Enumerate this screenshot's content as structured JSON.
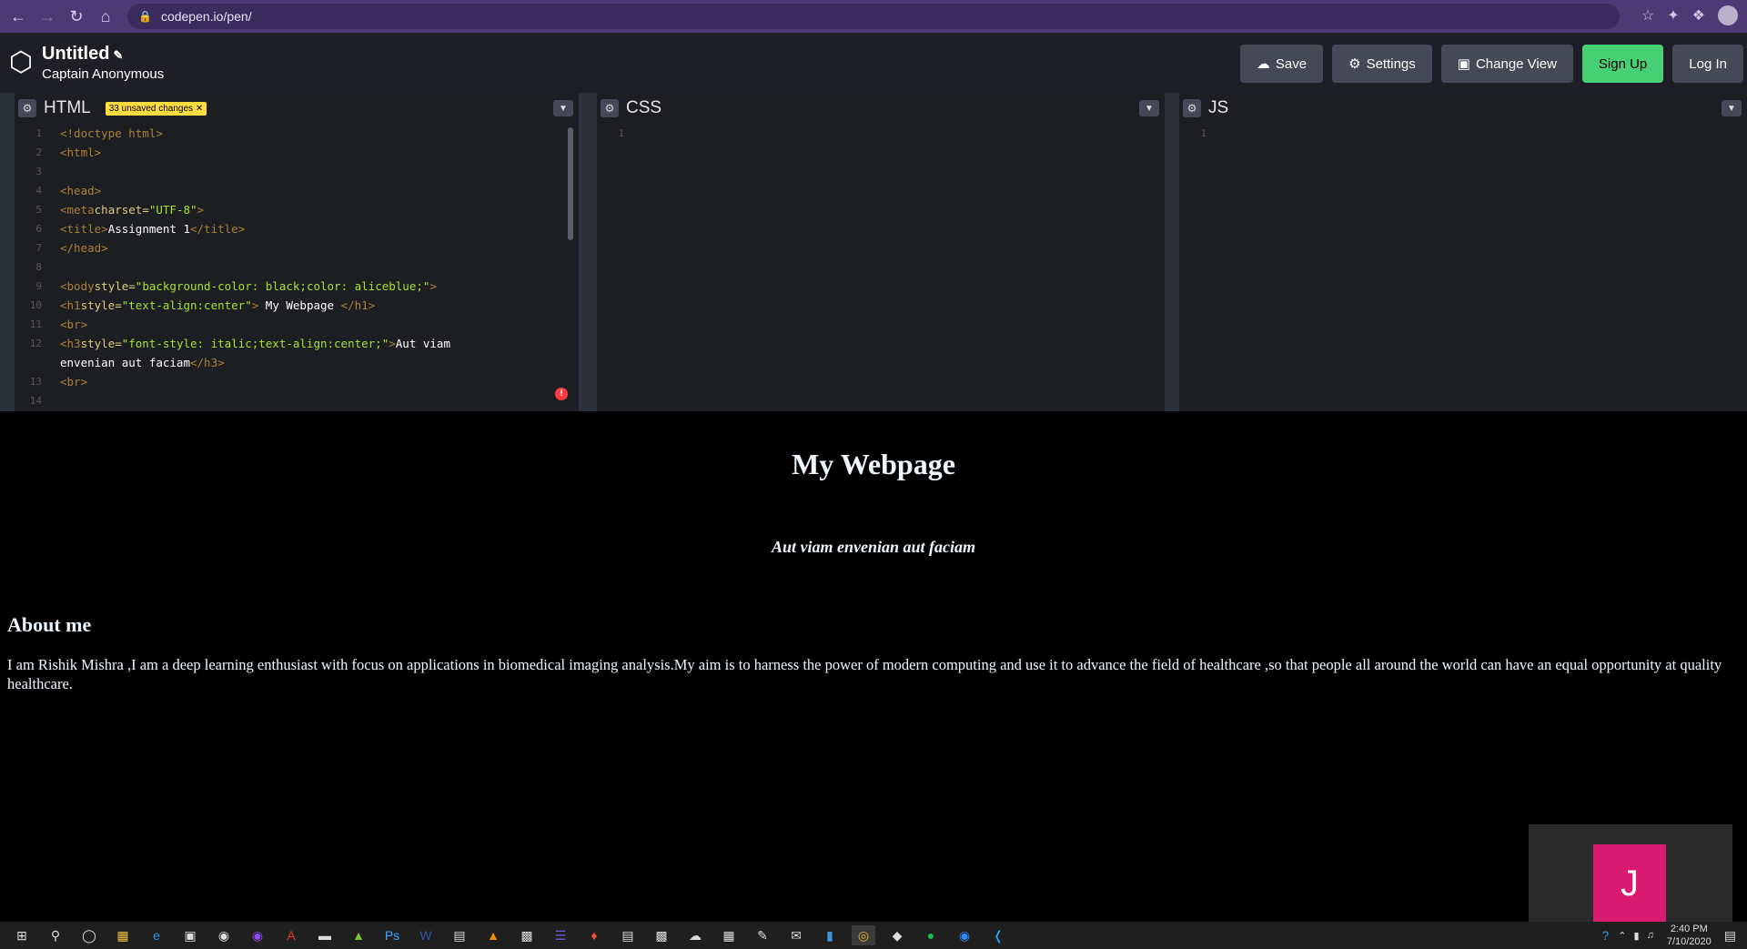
{
  "browser": {
    "url": "codepen.io/pen/"
  },
  "header": {
    "title": "Untitled",
    "author": "Captain Anonymous",
    "buttons": {
      "save": "Save",
      "settings": "Settings",
      "change_view": "Change View",
      "signup": "Sign Up",
      "login": "Log In"
    }
  },
  "editors": {
    "html": {
      "name": "HTML",
      "badge": "33 unsaved changes",
      "line_numbers": [
        "1",
        "2",
        "3",
        "4",
        "5",
        "6",
        "7",
        "8",
        "9",
        "10",
        "11",
        "12",
        "",
        "13",
        "14"
      ]
    },
    "css": {
      "name": "CSS",
      "line_number": "1"
    },
    "js": {
      "name": "JS",
      "line_number": "1"
    }
  },
  "preview": {
    "h1": "My Webpage",
    "h3": "Aut viam envenian aut faciam",
    "h2": "About me",
    "paragraph": "I am Rishik Mishra ,I am a deep learning enthusiast with focus on applications in biomedical imaging analysis.My aim is to harness the power of modern computing and use it to advance the field of healthcare ,so that people all around the world can have an equal opportunity at quality healthcare."
  },
  "video_tile": {
    "initial": "J"
  },
  "taskbar": {
    "time": "2:40 PM",
    "date": "7/10/2020"
  },
  "colors": {
    "chrome": "#4b3a76",
    "editor_bg": "#1d1e22",
    "signup": "#47cf73",
    "badge": "#ffdd40",
    "avatar": "#d81b71"
  }
}
